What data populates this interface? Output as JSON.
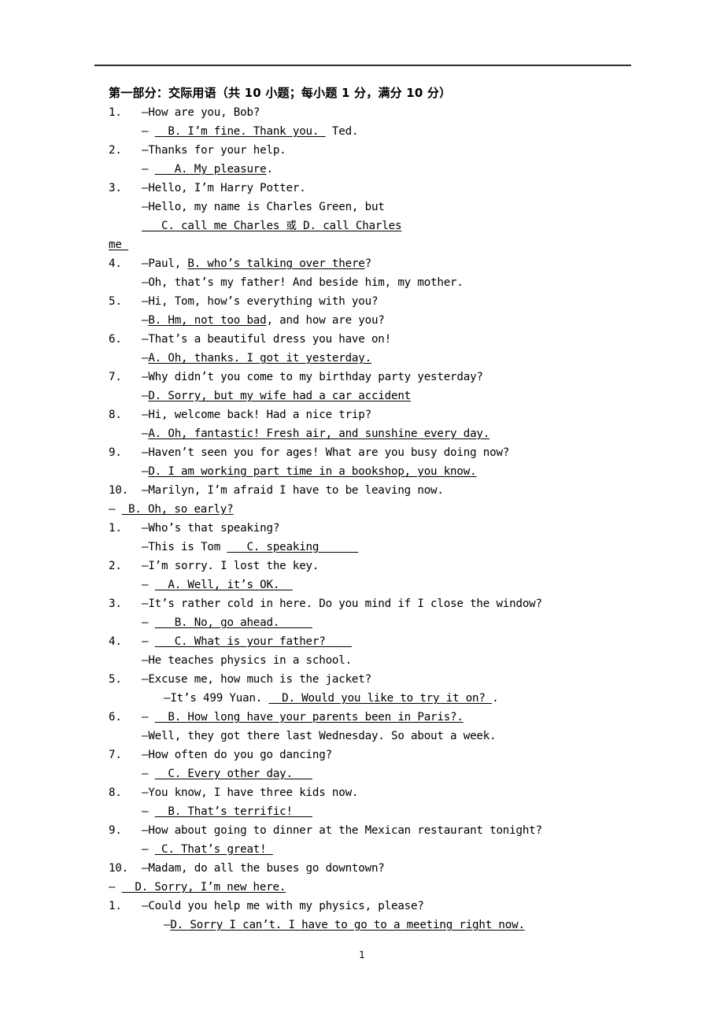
{
  "document": {
    "section_title": "第一部分：交际用语（共 10 小题；每小题 1 分，满分 10 分）",
    "page_number": "1"
  },
  "items": [
    {
      "number": "1.",
      "prompt": "—How are you, Bob?",
      "answer_lead": "— ",
      "answer_blank": "  B. I’m fine. Thank you. ",
      "answer_tail": " Ted.",
      "answer_indent": "ind-1"
    },
    {
      "number": "2.",
      "prompt": "—Thanks for your help.",
      "answer_lead": "— ",
      "answer_blank": "   A. My pleasure",
      "answer_tail": ".",
      "answer_indent": "ind-1"
    },
    {
      "number": "3.",
      "prompt": "—Hello, I’m Harry Potter.",
      "answer_indent": "ind-1"
    }
  ],
  "lines": [
    {
      "kind": "q",
      "num": "1.",
      "text": "—How are you, Bob?"
    },
    {
      "kind": "a",
      "indent": "ind-1",
      "lead": "— ",
      "blank": "  B. I’m fine. Thank you. ",
      "tail": " Ted."
    },
    {
      "kind": "q",
      "num": "2.",
      "text": "—Thanks for your help."
    },
    {
      "kind": "a",
      "indent": "ind-1",
      "lead": "— ",
      "blank": "   A. My pleasure",
      "tail": "."
    },
    {
      "kind": "q",
      "num": "3.",
      "text": "—Hello, I’m Harry Potter."
    },
    {
      "kind": "a3",
      "indent": "ind-1",
      "pre": "—Hello, my name is Charles Green, but ",
      "blank": "   C. call me Charles ",
      "cjk": "或",
      "blank2": " D. call Charles",
      "wrap": "me "
    },
    {
      "kind": "q2",
      "num": "4.",
      "pre": "—Paul, ",
      "blank": "B. who’s talking over there",
      "tail": "?"
    },
    {
      "kind": "a",
      "indent": "ind-1",
      "lead": "",
      "blank": "",
      "tail": "—Oh, that’s my father! And beside him, my mother."
    },
    {
      "kind": "q",
      "num": "5.",
      "text": "—Hi, Tom, how’s everything with you?"
    },
    {
      "kind": "a2",
      "indent": "ind-1",
      "lead": "—",
      "blank": "B. Hm, not too bad",
      "tail": ", and how are you?"
    },
    {
      "kind": "q",
      "num": "6.",
      "text": "—That’s a beautiful dress you have on!"
    },
    {
      "kind": "a2",
      "indent": "ind-1",
      "lead": "—",
      "blank": "A. Oh, thanks. I got it yesterday.",
      "tail": ""
    },
    {
      "kind": "q",
      "num": "7.",
      "text": "—Why didn’t you come to my birthday party yesterday?"
    },
    {
      "kind": "a2",
      "indent": "ind-1",
      "lead": "—",
      "blank": "D. Sorry, but my wife had a car accident",
      "tail": ""
    },
    {
      "kind": "q",
      "num": "8.",
      "text": "—Hi, welcome back! Had a nice trip?"
    },
    {
      "kind": "a2",
      "indent": "ind-1",
      "lead": "—",
      "blank": "A. Oh, fantastic! Fresh air, and sunshine every day.",
      "tail": ""
    },
    {
      "kind": "q",
      "num": "9.",
      "text": "—Haven’t seen you for ages! What are you busy doing now?"
    },
    {
      "kind": "a2",
      "indent": "ind-1",
      "lead": "—",
      "blank": "D. I am working part time in a bookshop, you know.",
      "tail": ""
    },
    {
      "kind": "q",
      "num": "10.",
      "text": "    —Marilyn, I’m afraid I have to be leaving now."
    },
    {
      "kind": "a",
      "indent": "ind-0",
      "lead": "— ",
      "blank": " B. Oh, so early?",
      "tail": ""
    },
    {
      "kind": "q",
      "num": "1.",
      "text": "—Who’s that speaking?"
    },
    {
      "kind": "a2",
      "indent": "ind-1",
      "lead": "—This is Tom ",
      "blank": "   C. speaking      ",
      "tail": ""
    },
    {
      "kind": "q",
      "num": "2.",
      "text": "—I’m sorry. I lost the key."
    },
    {
      "kind": "a",
      "indent": "ind-1",
      "lead": "— ",
      "blank": "  A. Well, it’s OK.  ",
      "tail": ""
    },
    {
      "kind": "q",
      "num": "3.",
      "text": "—It’s rather cold in here. Do you mind if I close the window?"
    },
    {
      "kind": "a",
      "indent": "ind-1",
      "lead": "— ",
      "blank": "   B. No, go ahead.     ",
      "tail": ""
    },
    {
      "kind": "q2",
      "num": "4.",
      "pre": "— ",
      "blank": "   C. What is your father?    ",
      "tail": ""
    },
    {
      "kind": "a",
      "indent": "ind-1",
      "lead": "",
      "blank": "",
      "tail": "—He teaches physics in a school."
    },
    {
      "kind": "q",
      "num": "5.",
      "text": "—Excuse me, how much is the jacket?"
    },
    {
      "kind": "a2",
      "indent": "ind-2",
      "lead": "—It’s 499 Yuan. ",
      "blank": "  D. Would you like to try it on? ",
      "tail": "."
    },
    {
      "kind": "q2",
      "num": "6.",
      "pre": "— ",
      "blank": "  B. How long have your parents been in Paris?.",
      "tail": ""
    },
    {
      "kind": "a",
      "indent": "ind-1",
      "lead": "",
      "blank": "",
      "tail": "—Well, they got there last Wednesday. So about a week."
    },
    {
      "kind": "q",
      "num": "7.",
      "text": "—How often do you go dancing?"
    },
    {
      "kind": "a",
      "indent": "ind-1",
      "lead": "— ",
      "blank": "  C. Every other day.   ",
      "tail": ""
    },
    {
      "kind": "q",
      "num": "8.",
      "text": "—You know, I have three kids now."
    },
    {
      "kind": "a",
      "indent": "ind-1",
      "lead": "— ",
      "blank": "  B. That’s terrific!   ",
      "tail": ""
    },
    {
      "kind": "q",
      "num": "9.",
      "text": "—How about going to dinner at the Mexican restaurant tonight?"
    },
    {
      "kind": "a",
      "indent": "ind-1",
      "lead": "— ",
      "blank": " C. That’s great! ",
      "tail": ""
    },
    {
      "kind": "q",
      "num": "10.",
      "text": "    —Madam, do all the buses go downtown?"
    },
    {
      "kind": "a",
      "indent": "ind-0",
      "lead": "— ",
      "blank": "  D. Sorry, I’m new here.",
      "tail": ""
    },
    {
      "kind": "q",
      "num": "1.",
      "text": "—Could you help me with my physics, please?"
    },
    {
      "kind": "a2",
      "indent": "ind-2",
      "lead": "—",
      "blank": "D. Sorry I can’t. I have to go to a meeting right now.",
      "tail": ""
    }
  ]
}
